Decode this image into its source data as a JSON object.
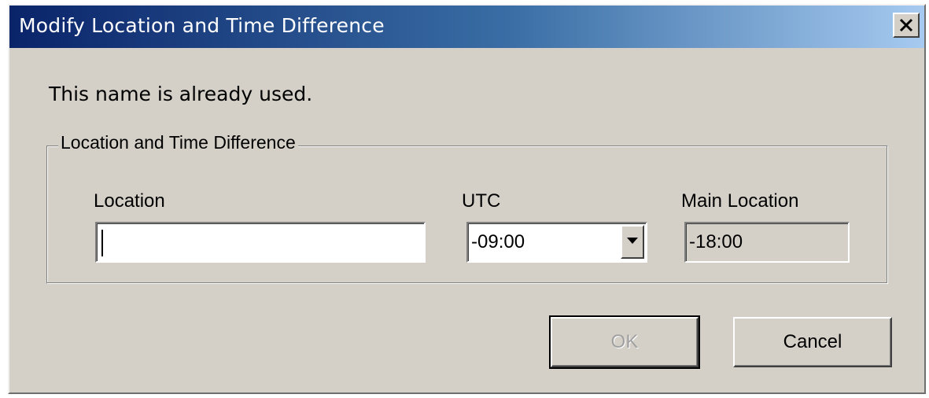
{
  "window": {
    "title": "Modify Location and Time Difference",
    "close_glyph": "×"
  },
  "message": "This name is already used.",
  "group": {
    "legend": "Location and Time Difference",
    "location": {
      "label": "Location",
      "value": ""
    },
    "utc": {
      "label": "UTC",
      "selected": "-09:00"
    },
    "main_location": {
      "label": "Main Location",
      "value": "-18:00"
    }
  },
  "buttons": {
    "ok_label": "OK",
    "ok_enabled": false,
    "cancel_label": "Cancel"
  },
  "colors": {
    "titlebar_start": "#0a246a",
    "titlebar_end": "#a6caf0",
    "face": "#d4d0c8",
    "disabled_text": "#a0a0a0"
  },
  "icons": {
    "close": "close-icon",
    "dropdown": "chevron-down-icon"
  }
}
